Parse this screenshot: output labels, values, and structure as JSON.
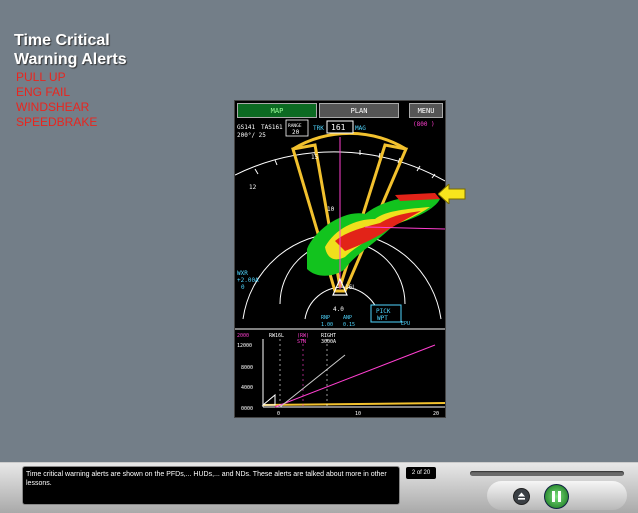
{
  "slide": {
    "title_line1": "Time Critical",
    "title_line2": "Warning Alerts",
    "alerts": [
      "PULL UP",
      "ENG FAIL",
      "WINDSHEAR",
      "SPEEDBRAKE"
    ]
  },
  "nd": {
    "tabs": {
      "map": "MAP",
      "plan": "PLAN",
      "menu": "MENU"
    },
    "gs": "GS141",
    "tas": "TAS161",
    "wind": "200°/ 25",
    "range_label": "RANGE",
    "range_value": "20",
    "trk_label": "TRK",
    "heading": "161",
    "mag_label": "MAG",
    "alt_setting": "(800 )",
    "arc_10": "10",
    "arc_15": "15",
    "arc_12": "12",
    "wxr_line1": "WXR",
    "wxr_line2": "+2.00A",
    "wxr_line3": "0",
    "bottom_labels": [
      "16L",
      "4.0",
      "FPA",
      "ANP",
      "RNP",
      "EPU",
      "1.00",
      "0.15"
    ],
    "pick_wpt_line1": "PICK",
    "pick_wpt_line2": "WPT",
    "vsd": {
      "header": [
        "2000",
        "RW16L",
        "(RW)",
        "STN",
        "RIGHT",
        "3000A"
      ],
      "alt_ticks": [
        "12000",
        "8000",
        "4000",
        "0000"
      ],
      "dist_ticks": [
        "0",
        "10",
        "20"
      ]
    }
  },
  "footer": {
    "caption": "Time critical warning alerts are shown on the PFDs,... HUDs,... and NDs. These alerts are talked about more in other lessons.",
    "page": "2 of 20"
  },
  "colors": {
    "alert_red": "#e8261f",
    "nd_background": "#000000",
    "magenta": "#ff3fd0",
    "cyan": "#4fd6ff",
    "amber": "#f2c12e"
  },
  "icons": [
    "yellow-callout-arrow-icon",
    "eject-icon",
    "pause-icon"
  ]
}
